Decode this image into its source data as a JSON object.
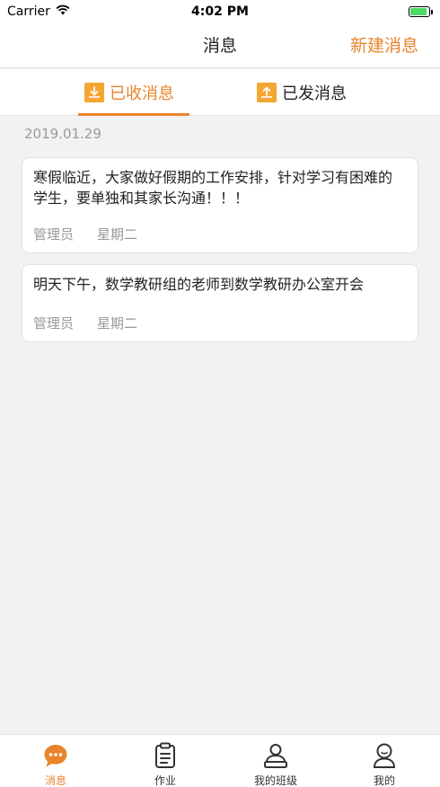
{
  "status_bar": {
    "carrier": "Carrier",
    "time": "4:02 PM",
    "battery_level": 0.9
  },
  "nav": {
    "title": "消息",
    "action_label": "新建消息"
  },
  "tabs": {
    "received_label": "已收消息",
    "sent_label": "已发消息",
    "active": "received"
  },
  "date_header": "2019.01.29",
  "messages": [
    {
      "text": "寒假临近，大家做好假期的工作安排，针对学习有困难的学生，要单独和其家长沟通！！！",
      "sender": "管理员",
      "day": "星期二"
    },
    {
      "text": "明天下午，数学教研组的老师到数学教研办公室开会",
      "sender": "管理员",
      "day": "星期二"
    }
  ],
  "tab_bar": [
    {
      "label": "消息",
      "icon": "chat-bubble-icon",
      "active": true
    },
    {
      "label": "作业",
      "icon": "clipboard-icon",
      "active": false
    },
    {
      "label": "我的班级",
      "icon": "person-desk-icon",
      "active": false
    },
    {
      "label": "我的",
      "icon": "profile-icon",
      "active": false
    }
  ],
  "colors": {
    "accent": "#e8842c",
    "tab_icon": "#f3a632",
    "battery": "#4cd964",
    "background": "#f2f2f2"
  }
}
